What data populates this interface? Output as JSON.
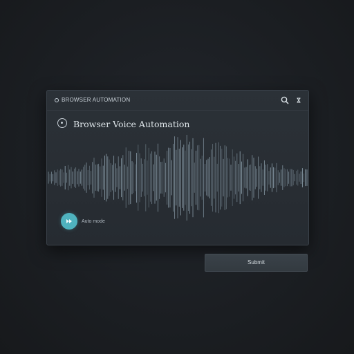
{
  "window": {
    "app_title": "BROWSER AUTOMATION",
    "heading": "Browser Voice Automation",
    "play_label": "Auto mode"
  },
  "action_button": {
    "label": "Submit"
  },
  "icons": {
    "app": "app-dot-icon",
    "search": "search-icon",
    "close": "close-icon",
    "heading": "record-icon",
    "play": "play-icon"
  },
  "colors": {
    "accent": "#4fb2be",
    "waveform": "#9fb4c2"
  }
}
